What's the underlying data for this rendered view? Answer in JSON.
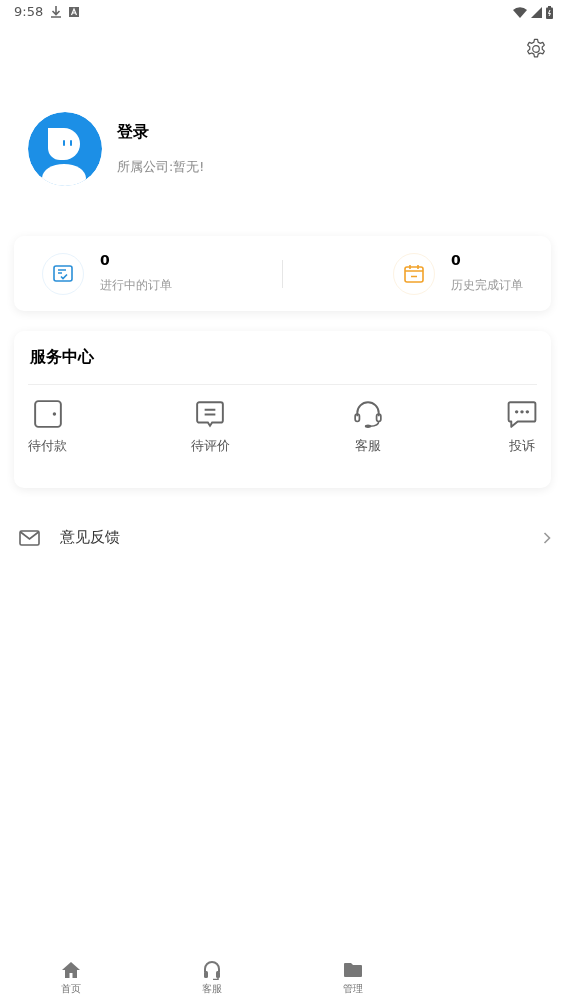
{
  "status_bar": {
    "time": "9:58"
  },
  "profile": {
    "name": "登录",
    "company": "所属公司:暂无!"
  },
  "orders": [
    {
      "kind": "ongoing",
      "count": "0",
      "label": "进行中的订单"
    },
    {
      "kind": "history",
      "count": "0",
      "label": "历史完成订单"
    }
  ],
  "service_center": {
    "title": "服务中心",
    "items": [
      {
        "kind": "payment",
        "label": "待付款"
      },
      {
        "kind": "review",
        "label": "待评价"
      },
      {
        "kind": "support",
        "label": "客服"
      },
      {
        "kind": "complaint",
        "label": "投诉"
      }
    ]
  },
  "menu": [
    {
      "kind": "mail",
      "label": "意见反馈"
    }
  ],
  "bottom_nav": [
    {
      "kind": "home",
      "label": "首页",
      "selected": false
    },
    {
      "kind": "support",
      "label": "客服",
      "selected": false
    },
    {
      "kind": "folder",
      "label": "管理",
      "selected": false
    }
  ]
}
